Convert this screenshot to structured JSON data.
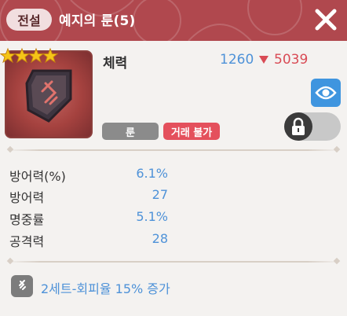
{
  "header": {
    "grade": "전설",
    "title": "예지의 룬(5)"
  },
  "item": {
    "stars": 4,
    "stat_name": "체력",
    "stat_old": "1260",
    "stat_new": "5039",
    "tag_type": "룬",
    "tag_trade": "거래 불가",
    "locked": true
  },
  "stats": [
    {
      "label": "방어력(%)",
      "value": "6.1%"
    },
    {
      "label": "방어력",
      "value": "27"
    },
    {
      "label": "명중률",
      "value": "5.1%"
    },
    {
      "label": "공격력",
      "value": "28"
    }
  ],
  "set_bonus": "2세트-회피율 15% 증가",
  "colors": {
    "header_bg": "#b0484e",
    "accent_blue": "#4e92d8",
    "accent_red": "#d94b55",
    "star": "#f5c518"
  },
  "icons": {
    "close": "close-icon",
    "eye": "eye-icon",
    "lock": "lock-icon",
    "set": "rune-set-icon"
  }
}
